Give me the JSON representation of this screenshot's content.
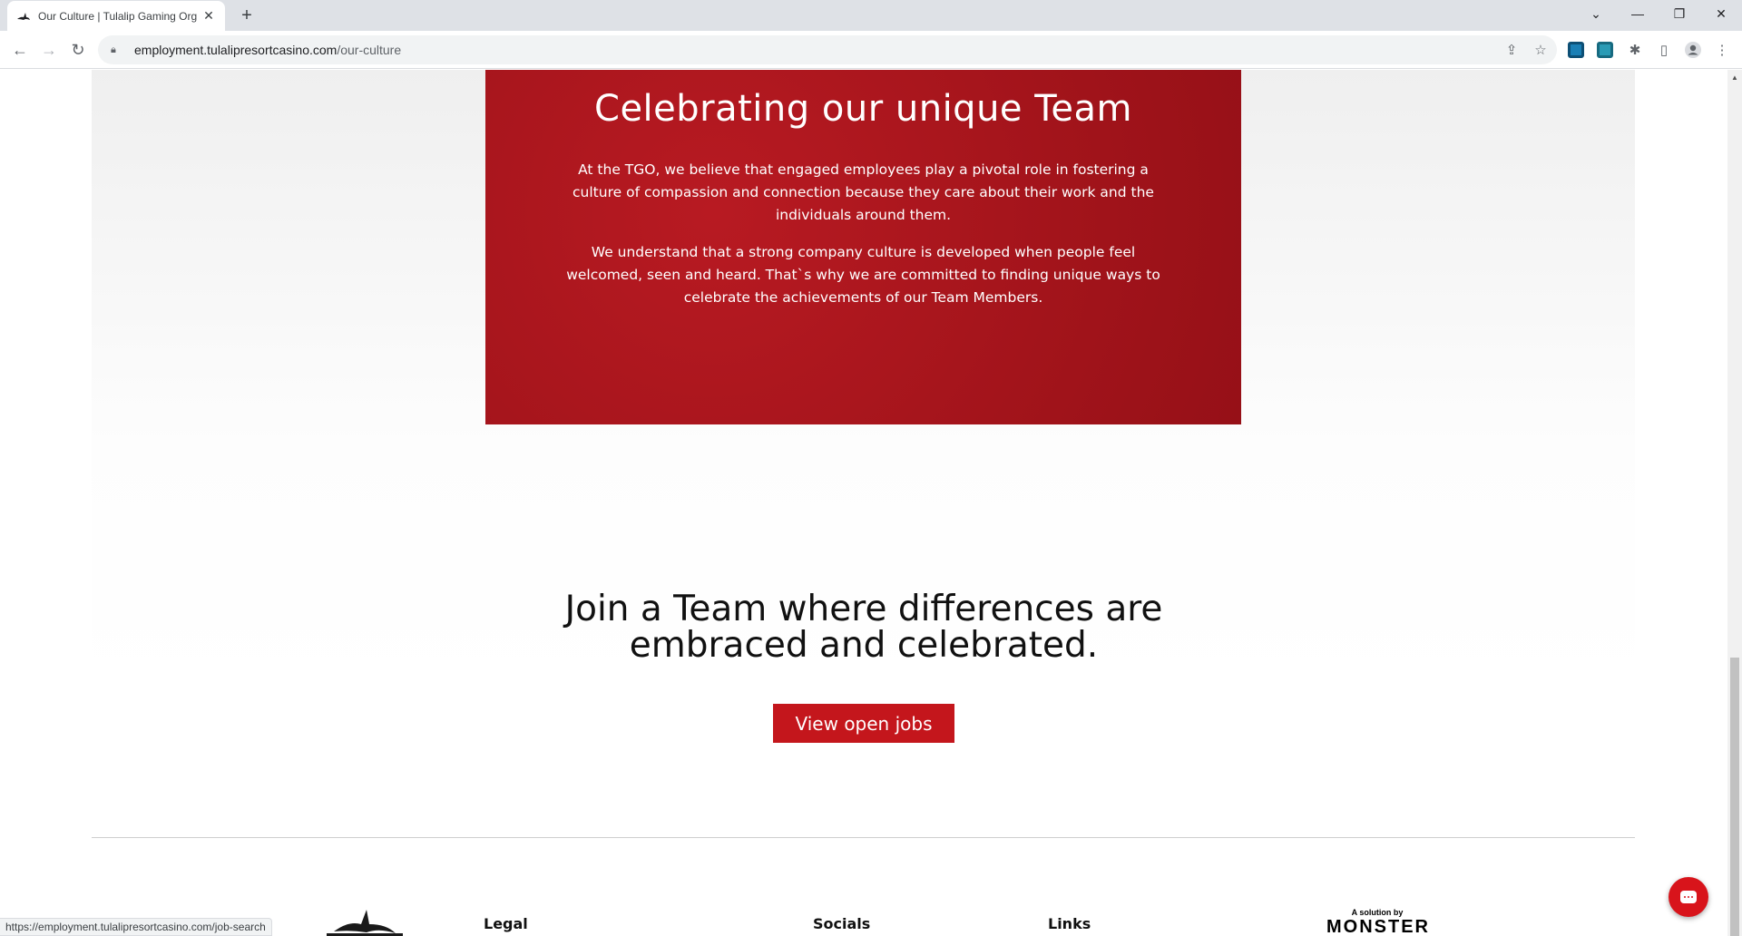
{
  "browser": {
    "tab_title": "Our Culture | Tulalip Gaming Org",
    "url_host": "employment.tulalipresortcasino.com",
    "url_path": "/our-culture",
    "status_url": "https://employment.tulalipresortcasino.com/job-search"
  },
  "culture_card": {
    "heading": "Celebrating our unique Team",
    "paragraph1": "At the TGO, we believe that engaged employees play a pivotal role in fostering a culture of compassion and connection because they care about their work and the individuals around them.",
    "paragraph2": "We understand that a strong company culture is developed when people feel welcomed, seen and heard. That`s why we are committed to finding unique ways to celebrate the achievements of our Team Members."
  },
  "join": {
    "heading": "Join a Team where differences are embraced and celebrated.",
    "button_label": "View open jobs"
  },
  "footer": {
    "legal_heading": "Legal",
    "socials_heading": "Socials",
    "links_heading": "Links",
    "monster_tagline": "A solution by",
    "monster_brand": "MONSTER"
  },
  "colors": {
    "brand_red": "#c4161c",
    "card_red": "#a3141b"
  }
}
